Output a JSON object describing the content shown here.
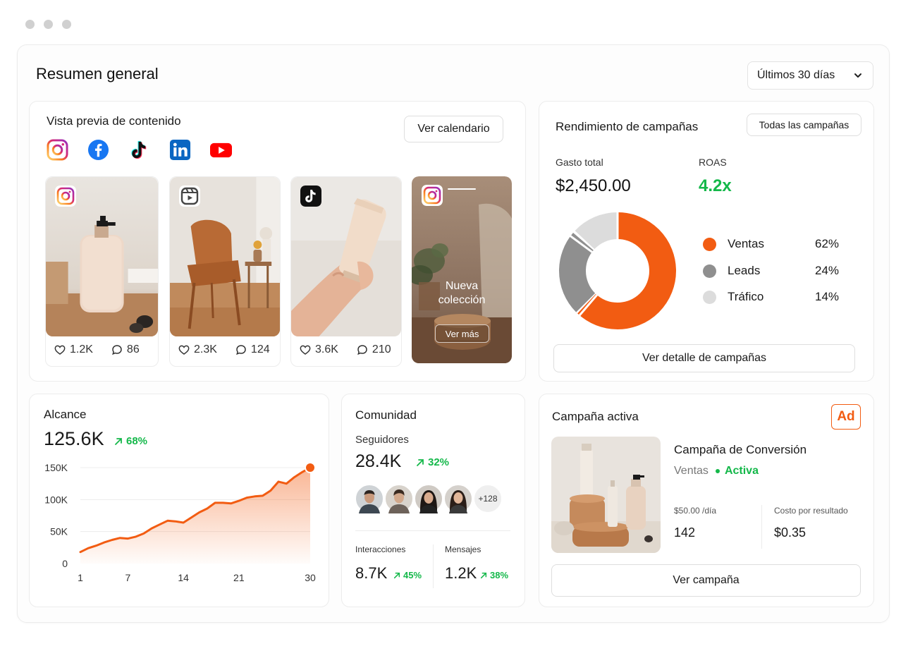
{
  "page": {
    "title": "Resumen general",
    "date_range": "Últimos 30 días"
  },
  "content_preview": {
    "title": "Vista previa de contenido",
    "calendar_button": "Ver calendario",
    "networks": [
      "instagram-icon",
      "facebook-icon",
      "tiktok-icon",
      "linkedin-icon",
      "youtube-icon"
    ],
    "posts": [
      {
        "network": "instagram",
        "likes": "1.2K",
        "comments": "86"
      },
      {
        "network": "reels",
        "likes": "2.3K",
        "comments": "124"
      },
      {
        "network": "tiktok",
        "likes": "3.6K",
        "comments": "210"
      }
    ],
    "story": {
      "network": "instagram",
      "headline_1": "Nueva",
      "headline_2": "colección",
      "cta": "Ver más"
    }
  },
  "campaigns": {
    "title": "Rendimiento de campañas",
    "filter_button": "Todas las campañas",
    "spend_label": "Gasto total",
    "spend_value": "$2,450.00",
    "roas_label": "ROAS",
    "roas_value": "4.2x",
    "legend": [
      {
        "label": "Ventas",
        "value": "62%",
        "color": "#f25c12"
      },
      {
        "label": "Leads",
        "value": "24%",
        "color": "#8f8f8f"
      },
      {
        "label": "Tráfico",
        "value": "14%",
        "color": "#dcdcdc"
      }
    ],
    "detail_button": "Ver detalle de campañas"
  },
  "reach": {
    "title": "Alcance",
    "value": "125.6K",
    "change": "68%"
  },
  "chart_data": {
    "type": "area",
    "title": "Alcance",
    "xlabel": "",
    "ylabel": "",
    "x_ticks": [
      "1",
      "7",
      "14",
      "21",
      "30"
    ],
    "y_ticks": [
      "150K",
      "100K",
      "50K",
      "0"
    ],
    "ylim": [
      0,
      150000
    ],
    "xlim": [
      1,
      30
    ],
    "grid": true,
    "color": "#f25c12",
    "series": [
      {
        "x": [
          1,
          2,
          3,
          4,
          5,
          6,
          7,
          8,
          9,
          10,
          11,
          12,
          13,
          14,
          15,
          16,
          17,
          18,
          19,
          20,
          21,
          22,
          23,
          24,
          25,
          26,
          27,
          28,
          29,
          30
        ],
        "values": [
          18000,
          24000,
          28000,
          33000,
          37000,
          40000,
          39000,
          42000,
          47000,
          55000,
          61000,
          67000,
          66000,
          64000,
          72000,
          80000,
          86000,
          95000,
          95000,
          94000,
          98000,
          103000,
          105000,
          106000,
          114000,
          128000,
          125000,
          135000,
          143000,
          150000
        ]
      }
    ]
  },
  "community": {
    "title": "Comunidad",
    "followers_label": "Seguidores",
    "followers_value": "28.4K",
    "followers_change": "32%",
    "avatars_more": "+128",
    "interactions_label": "Interacciones",
    "interactions_value": "8.7K",
    "interactions_change": "45%",
    "messages_label": "Mensajes",
    "messages_value": "1.2K",
    "messages_change": "38%"
  },
  "active_campaign": {
    "title": "Campaña activa",
    "ad_badge": "Ad",
    "name": "Campaña de Conversión",
    "objective": "Ventas",
    "status": "Activa",
    "budget_label": "$50.00 /día",
    "budget_value": "142",
    "cpr_label": "Costo por resultado",
    "cpr_value": "$0.35",
    "view_button": "Ver campaña"
  }
}
